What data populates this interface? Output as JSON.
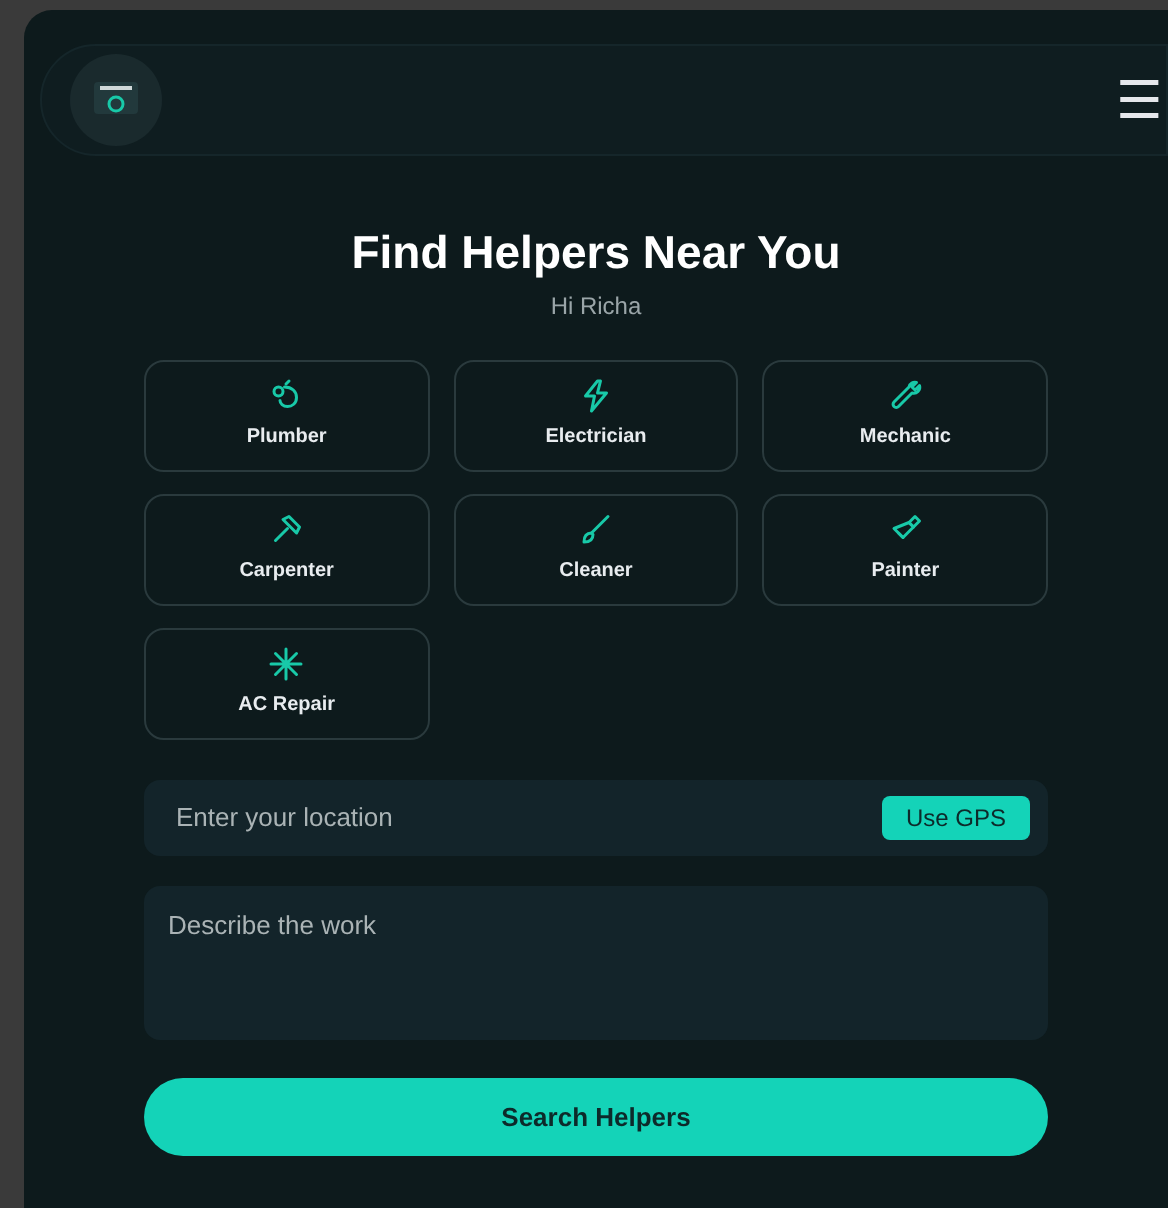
{
  "header": {
    "menu": "☰"
  },
  "title": "Find Helpers Near You",
  "greeting": "Hi Richa",
  "services": [
    {
      "label": "Plumber",
      "kind": "plumber"
    },
    {
      "label": "Electrician",
      "kind": "electrician"
    },
    {
      "label": "Mechanic",
      "kind": "mechanic"
    },
    {
      "label": "Carpenter",
      "kind": "carpenter"
    },
    {
      "label": "Cleaner",
      "kind": "cleaner"
    },
    {
      "label": "Painter",
      "kind": "painter"
    },
    {
      "label": "AC Repair",
      "kind": "ac"
    }
  ],
  "location": {
    "placeholder": "Enter your location",
    "button": "Use GPS"
  },
  "description": {
    "placeholder": "Describe the work"
  },
  "search_button": "Search Helpers"
}
